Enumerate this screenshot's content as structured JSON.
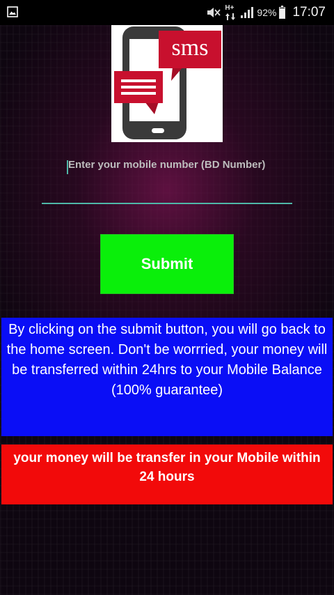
{
  "status_bar": {
    "network_label": "H+",
    "battery_level": "92%",
    "battery_fraction": 0.92,
    "time": "17:07",
    "icons": [
      "gallery-icon",
      "mute-icon",
      "data-arrows-icon",
      "signal-icon",
      "battery-icon"
    ]
  },
  "logo": {
    "text": "sms",
    "colors": {
      "phone": "#3a3a3a",
      "bubble": "#c8102e",
      "screen": "#ffffff"
    }
  },
  "form": {
    "mobile_input": {
      "value": "",
      "placeholder": "Enter your mobile number (BD Number)"
    },
    "submit_label": "Submit"
  },
  "messages": {
    "info": "By clicking on the submit button, you will go back to the home screen. Don't be worrried, your money will be transferred within 24hrs to your Mobile Balance (100% guarantee)",
    "warning": "your money will be transfer in your Mobile within 24 hours"
  },
  "colors": {
    "accent": "#4fb8a8",
    "submit": "#0aef0a",
    "info_bg": "#0a0ef6",
    "warning_bg": "#f20a0a"
  }
}
